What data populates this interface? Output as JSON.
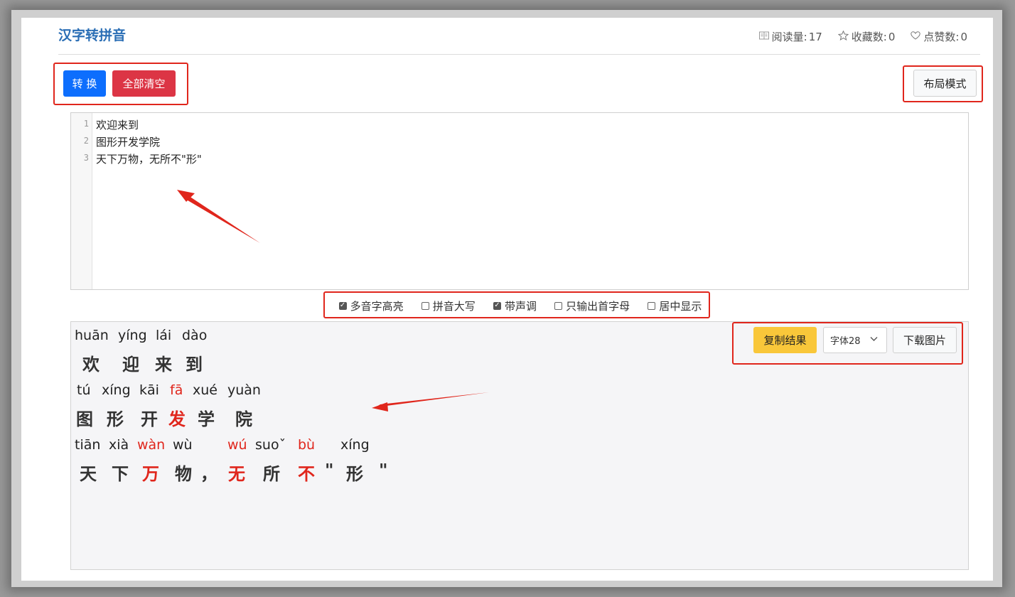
{
  "header": {
    "title": "汉字转拼音",
    "stats": {
      "reads_label": "阅读量:",
      "reads_value": "17",
      "favorites_label": "收藏数:",
      "favorites_value": "0",
      "likes_label": "点赞数:",
      "likes_value": "0"
    }
  },
  "toolbar": {
    "convert_label": "转 换",
    "clear_label": "全部清空",
    "layout_label": "布局模式"
  },
  "editor": {
    "lines": [
      {
        "num": "1",
        "text": "欢迎来到"
      },
      {
        "num": "2",
        "text": "图形开发学院"
      },
      {
        "num": "3",
        "text": "天下万物，无所不\"形\""
      }
    ]
  },
  "options": [
    {
      "label": "多音字高亮",
      "checked": true
    },
    {
      "label": "拼音大写",
      "checked": false
    },
    {
      "label": "带声调",
      "checked": true
    },
    {
      "label": "只输出首字母",
      "checked": false
    },
    {
      "label": "居中显示",
      "checked": false
    }
  ],
  "result": {
    "copy_label": "复制结果",
    "font_select_value": "字体28",
    "download_label": "下载图片",
    "lines": [
      [
        {
          "py": "huān",
          "hz": "欢",
          "poly": false
        },
        {
          "py": "yíng",
          "hz": "迎",
          "poly": false
        },
        {
          "py": "lái",
          "hz": "来",
          "poly": false
        },
        {
          "py": "dào",
          "hz": "到",
          "poly": false
        }
      ],
      [
        {
          "py": "tú",
          "hz": "图",
          "poly": false
        },
        {
          "py": "xíng",
          "hz": "形",
          "poly": false
        },
        {
          "py": "kāi",
          "hz": "开",
          "poly": false
        },
        {
          "py": "fā",
          "hz": "发",
          "poly": true
        },
        {
          "py": "xué",
          "hz": "学",
          "poly": false
        },
        {
          "py": "yuàn",
          "hz": "院",
          "poly": false
        }
      ],
      [
        {
          "py": "tiān",
          "hz": "天",
          "poly": false
        },
        {
          "py": "xià",
          "hz": "下",
          "poly": false
        },
        {
          "py": "wàn",
          "hz": "万",
          "poly": true
        },
        {
          "py": "wù",
          "hz": "物",
          "poly": false
        },
        {
          "py": "",
          "hz": "，",
          "poly": false
        },
        {
          "py": "wú",
          "hz": "无",
          "poly": true
        },
        {
          "py": "suoˇ",
          "hz": "所",
          "poly": false
        },
        {
          "py": "bù",
          "hz": "不",
          "poly": true
        },
        {
          "py": "",
          "hz": "\"",
          "poly": false
        },
        {
          "py": "xíng",
          "hz": "形",
          "poly": false
        },
        {
          "py": "",
          "hz": "\"",
          "poly": false
        }
      ]
    ]
  },
  "colors": {
    "title": "#2a6eb5",
    "primary": "#0d6efd",
    "danger": "#dc3545",
    "warning": "#f9c73a",
    "highlight": "#e0261c",
    "annotation_red": "#e0261c"
  },
  "icons": {
    "reads": "book-icon",
    "favorites": "star-icon",
    "likes": "heart-icon",
    "select": "chevron-down-icon"
  }
}
